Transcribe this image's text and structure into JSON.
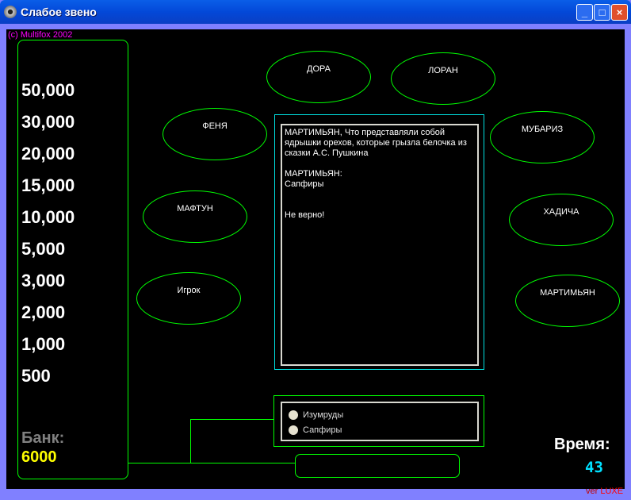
{
  "window": {
    "title": "Слабое звено"
  },
  "copyright": "(c) Multifox 2002",
  "money_ladder": [
    "50,000",
    "30,000",
    "20,000",
    "15,000",
    "10,000",
    "5,000",
    "3,000",
    "2,000",
    "1,000",
    "500"
  ],
  "bank": {
    "label": "Банк:",
    "value": "6000"
  },
  "players": [
    "ДОРА",
    "ЛОРАН",
    "ФЕНЯ",
    "МУБАРИЗ",
    "МАФТУН",
    "ХАДИЧА",
    "Игрок",
    "МАРТИМЬЯН"
  ],
  "question_log": "МАРТИМЬЯН, Что представляли собой ядрышки орехов, которые грызла белочка из сказки А.С. Пушкина\n\nМАРТИМЬЯН:\nСапфиры\n\n\nНе верно!",
  "options": [
    "Изумруды",
    "Сапфиры"
  ],
  "timer": {
    "label": "Время:",
    "value": "43"
  },
  "version": {
    "prefix": "ver ",
    "name": "LUXE"
  }
}
